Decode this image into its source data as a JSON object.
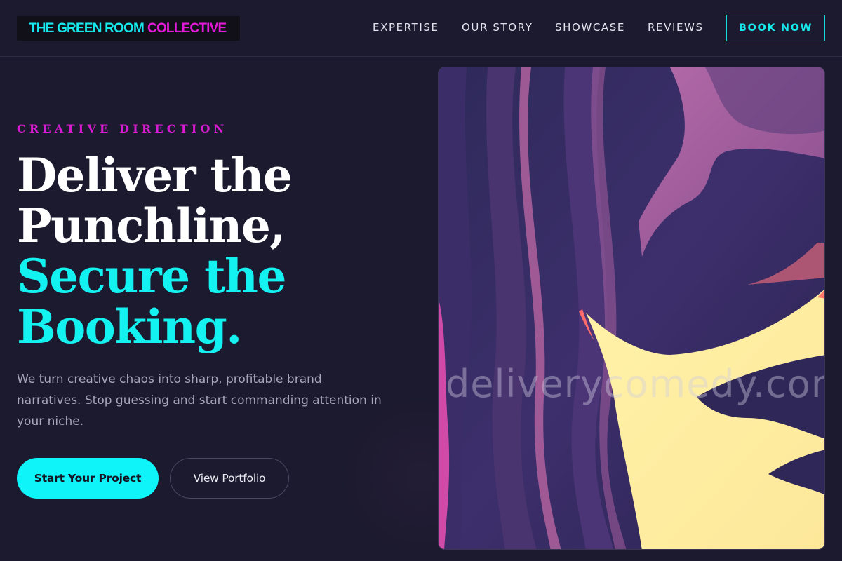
{
  "header": {
    "logo_part1": "THE GREEN ROOM",
    "logo_part2": "COLLECTIVE",
    "nav": [
      {
        "label": "EXPERTISE"
      },
      {
        "label": "OUR STORY"
      },
      {
        "label": "SHOWCASE"
      },
      {
        "label": "REVIEWS"
      }
    ],
    "cta_label": "BOOK NOW"
  },
  "hero": {
    "eyebrow": "CREATIVE DIRECTION",
    "headline_line1": "Deliver the",
    "headline_line2": "Punchline,",
    "headline_line3": "Secure the",
    "headline_line4": "Booking.",
    "lede": "We turn creative chaos into sharp, profitable brand narratives. Stop guessing and start commanding attention in your niche.",
    "primary_cta": "Start Your Project",
    "secondary_cta": "View Portfolio",
    "image_watermark": "deliverycomedy.com"
  },
  "colors": {
    "background": "#1c1a2e",
    "accent_cyan": "#0ff4f8",
    "accent_magenta": "#e21ad8"
  }
}
